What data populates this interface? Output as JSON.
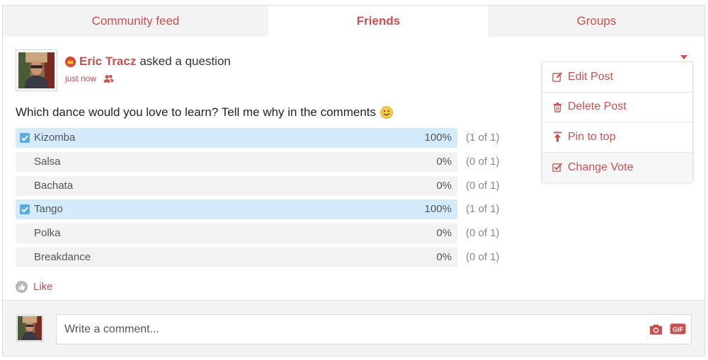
{
  "tabs": [
    {
      "label": "Community feed",
      "active": false
    },
    {
      "label": "Friends",
      "active": true
    },
    {
      "label": "Groups",
      "active": false
    }
  ],
  "post": {
    "author": "Eric Tracz",
    "action": "asked a question",
    "time": "just now",
    "audience_icon": "friends-icon",
    "question": "Which dance would you love to learn? Tell me why in the comments",
    "options": [
      {
        "label": "Kizomba",
        "percent": "100%",
        "count": "(1 of 1)",
        "fraction": 1.0,
        "voted": true
      },
      {
        "label": "Salsa",
        "percent": "0%",
        "count": "(0 of 1)",
        "fraction": 0.0,
        "voted": false
      },
      {
        "label": "Bachata",
        "percent": "0%",
        "count": "(0 of 1)",
        "fraction": 0.0,
        "voted": false
      },
      {
        "label": "Tango",
        "percent": "100%",
        "count": "(1 of 1)",
        "fraction": 1.0,
        "voted": true
      },
      {
        "label": "Polka",
        "percent": "0%",
        "count": "(0 of 1)",
        "fraction": 0.0,
        "voted": false
      },
      {
        "label": "Breakdance",
        "percent": "0%",
        "count": "(0 of 1)",
        "fraction": 0.0,
        "voted": false
      }
    ],
    "like_label": "Like"
  },
  "menu": {
    "items": [
      {
        "label": "Edit Post",
        "icon": "edit-icon"
      },
      {
        "label": "Delete Post",
        "icon": "trash-icon"
      },
      {
        "label": "Pin to top",
        "icon": "pin-icon"
      },
      {
        "label": "Change Vote",
        "icon": "checkbox-icon"
      }
    ]
  },
  "comment": {
    "placeholder": "Write a comment...",
    "camera_icon": "camera-icon",
    "gif_label": "GIF"
  },
  "colors": {
    "accent": "#c9504f",
    "vote_fill": "#d3ebfa",
    "bar_bg": "#f2f2f2",
    "check": "#5aace3"
  }
}
